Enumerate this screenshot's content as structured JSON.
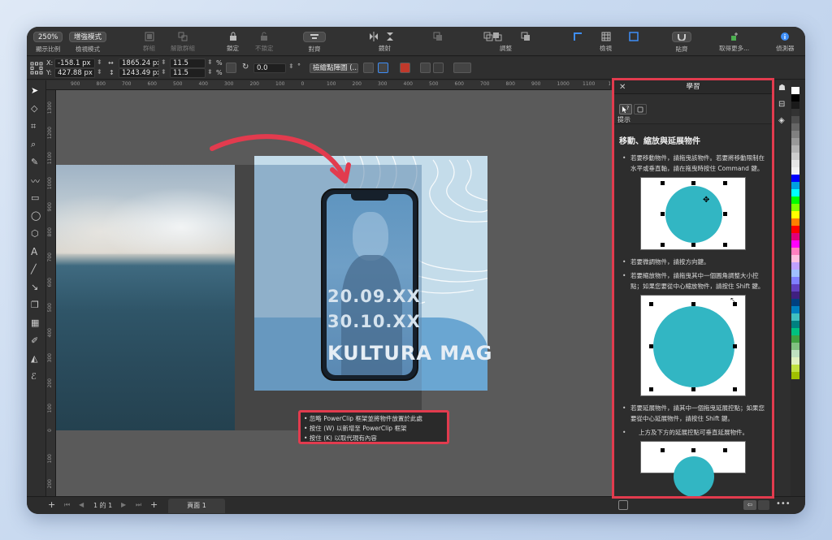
{
  "toolbar": {
    "zoom": "250%",
    "zoom_label": "顯示比例",
    "view_mode": "增強模式",
    "view_mode_label": "檢視模式",
    "group_label": "群組",
    "ungroup_label": "解散群組",
    "lock_label": "鎖定",
    "unlock_label": "不鎖定",
    "align_label": "對齊",
    "mirror_label": "鏡射",
    "arrange_label": "調整",
    "view_label": "檢視",
    "snap_label": "貼齊",
    "more_label": "取得更多...",
    "inspector_label": "偵測器"
  },
  "propbar": {
    "x_label": "X:",
    "y_label": "Y:",
    "x_value": "-158.1 px",
    "y_value": "427.88 px",
    "w_value": "1865.24 px",
    "h_value": "1243.49 px",
    "sx_value": "11.5",
    "sy_value": "11.5",
    "percent": "%",
    "rotation": "0.0",
    "degree": "°",
    "resample": "檢繪點陣圖 (..."
  },
  "ruler": {
    "h_ticks": [
      "900",
      "800",
      "700",
      "600",
      "500",
      "400",
      "300",
      "200",
      "100",
      "0",
      "100",
      "200",
      "300",
      "400",
      "500",
      "600",
      "700",
      "800",
      "900",
      "1000",
      "1100",
      "1200"
    ],
    "v_ticks": [
      "1300",
      "1200",
      "1100",
      "1000",
      "900",
      "800",
      "700",
      "600",
      "500",
      "400",
      "300",
      "200",
      "100",
      "0",
      "100",
      "200"
    ]
  },
  "artwork": {
    "date1": "20.09.XX",
    "date2": "30.10.XX",
    "title": "KULTURA MAG"
  },
  "hint": {
    "line1": "• 忽略 PowerClip 框架並將物件放置於此處",
    "line2": "• 按住 (W) 以新增至 PowerClip 框架",
    "line3": "• 按住 (K) 以取代現有內容"
  },
  "bottombar": {
    "page_counter": "1 的 1",
    "page_tab": "頁面 1"
  },
  "learn": {
    "title": "學習",
    "tab_label": "提示",
    "heading": "移動、縮放與延展物件",
    "b1": "若要移動物件，請拖曳該物件。若要將移動限制在水平或垂直軸，請在拖曳時按住 Command 鍵。",
    "b2": "若要微調物件，請按方向鍵。",
    "b3": "若要縮放物件，請拖曳其中一個圓角調整大小控點；如果您要從中心縮放物件，請按住 Shift 鍵。",
    "b4": "若要延展物件，請其中一個拖曳延展控點；如果您要從中心延展物件，請按住 Shift 鍵。",
    "b5": "上方及下方的延展控點可垂直延展物件。"
  },
  "colors": {
    "accent": "#e23b4e",
    "palette": [
      "#ffffff",
      "#000000",
      "#1a1a1a",
      "#333333",
      "#4d4d4d",
      "#666666",
      "#808080",
      "#999999",
      "#b3b3b3",
      "#cccccc",
      "#e6e6e6",
      "#f2f2f2",
      "#0000ff",
      "#00a0e0",
      "#00ffff",
      "#00ff00",
      "#80ff00",
      "#ffff00",
      "#ff8000",
      "#ff0000",
      "#e0007a",
      "#ff00ff",
      "#ff80c0",
      "#ffc0e0",
      "#c0a0ff",
      "#a0c0ff",
      "#8080ff",
      "#6040c0",
      "#402080",
      "#004080",
      "#0080c0",
      "#40c0c0",
      "#008080",
      "#00c080",
      "#40a040",
      "#80c080",
      "#c0e0c0",
      "#e0f0c0",
      "#c0e040",
      "#a0c000"
    ]
  }
}
